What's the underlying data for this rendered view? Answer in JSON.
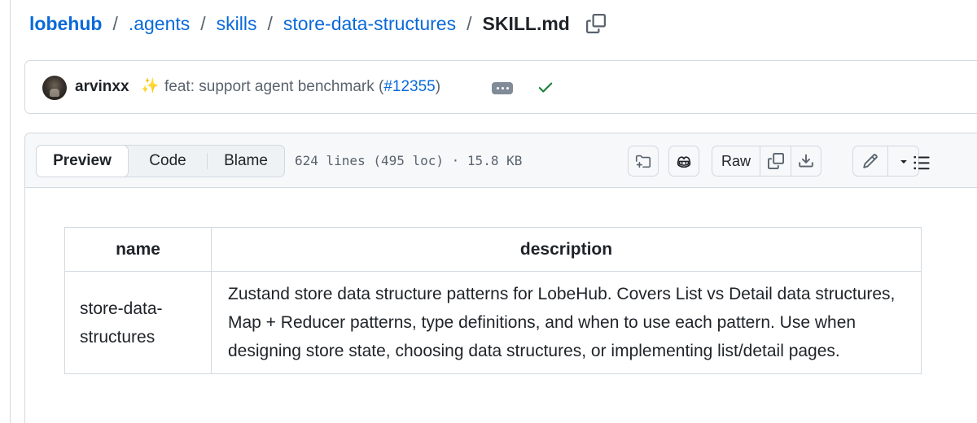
{
  "breadcrumb": {
    "owner": "lobehub",
    "items": [
      ".agents",
      "skills",
      "store-data-structures"
    ],
    "current": "SKILL.md",
    "separator": "/"
  },
  "commit": {
    "author": "arvinxx",
    "sparkle": "✨",
    "message": "feat: support agent benchmark (",
    "pr": "#12355",
    "message_end": ")",
    "status": "check-success"
  },
  "file": {
    "tabs": [
      "Preview",
      "Code",
      "Blame"
    ],
    "active_tab": "Preview",
    "meta": "624 lines (495 loc) · 15.8 KB",
    "raw_label": "Raw"
  },
  "frontmatter": {
    "headers": [
      "name",
      "description"
    ],
    "name": "store-data-structures",
    "name_line1": "store-data-",
    "name_line2": "structures",
    "description": "Zustand store data structure patterns for LobeHub. Covers List vs Detail data structures, Map + Reducer patterns, type definitions, and when to use each pattern. Use when designing store state, choosing data structures, or implementing list/detail pages."
  },
  "colors": {
    "link": "#0969da",
    "text": "#1f2328",
    "muted": "#59636e",
    "border": "#d1d9e0",
    "success": "#1a7f37",
    "header_bg": "#f6f8fa"
  }
}
